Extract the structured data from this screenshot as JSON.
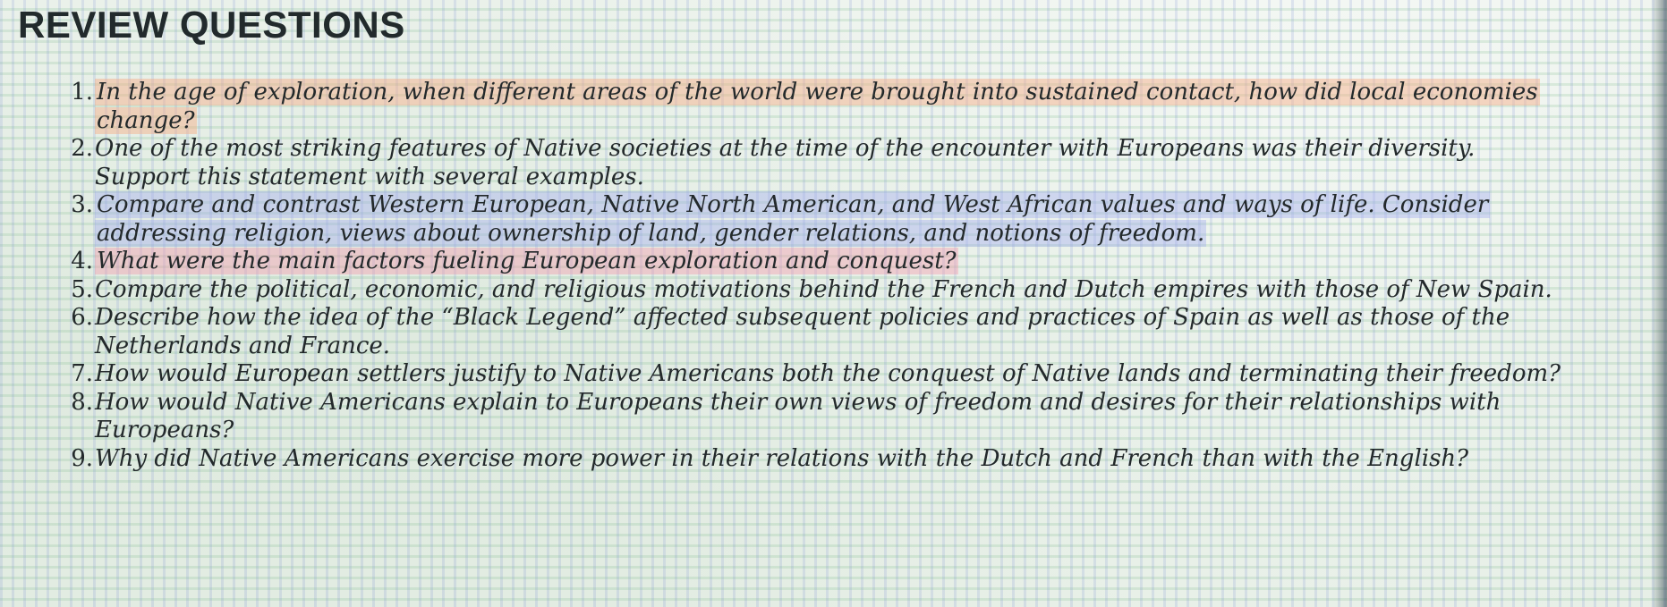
{
  "heading": "REVIEW QUESTIONS",
  "questions": [
    {
      "number": "1.",
      "text": "In the age of exploration, when different areas of the world were brought into sustained contact, how did local economies change?"
    },
    {
      "number": "2.",
      "text": "One of the most striking features of Native societies at the time of the encounter with Europeans was their diversity. Support this statement with several examples."
    },
    {
      "number": "3.",
      "text": "Compare and contrast Western European, Native North American, and West African values and ways of life. Consider addressing religion, views about ownership of land, gender relations, and notions of freedom."
    },
    {
      "number": "4.",
      "text": "What were the main factors fueling European exploration and conquest?"
    },
    {
      "number": "5.",
      "text": "Compare the political, economic, and religious motivations behind the French and Dutch empires with those of New Spain."
    },
    {
      "number": "6.",
      "text": "Describe how the idea of the “Black Legend” affected subsequent policies and practices of Spain as well as those of the Netherlands and France."
    },
    {
      "number": "7.",
      "text": "How would European settlers justify to Native Americans both the conquest of Native lands and terminating their freedom?"
    },
    {
      "number": "8.",
      "text": "How would Native Americans explain to Europeans their own views of freedom and desires for their relationships with Europeans?"
    },
    {
      "number": "9.",
      "text": "Why did Native Americans exercise more power in their relations with the Dutch and French than with the English?"
    }
  ]
}
